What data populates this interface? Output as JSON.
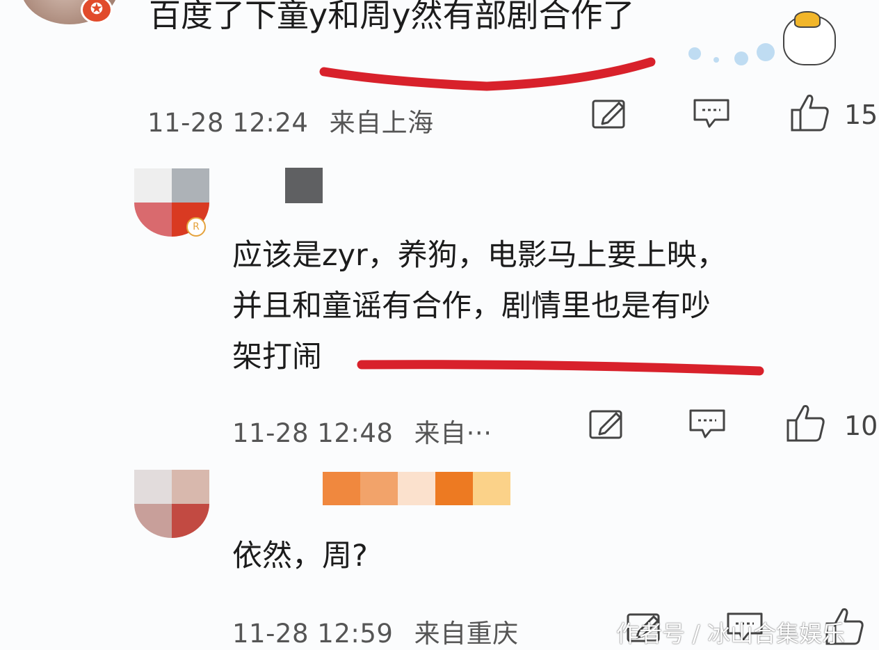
{
  "top_comment": {
    "text": "百度了下童y和周y然有部剧合作了",
    "time": "11-28 12:24",
    "source": "来自上海",
    "like_count": "15"
  },
  "reply_1": {
    "lines": [
      "应该是zyr，养狗，电影马上要上映，",
      "并且和童谣有合作，剧情里也是有吵",
      "架打闹"
    ],
    "time": "11-28 12:48",
    "source": "来自···",
    "like_count": "10"
  },
  "reply_2": {
    "text": "依然，周?",
    "time": "11-28 12:59",
    "source": "来自重庆"
  },
  "watermark": "作者号 / 冰山合集娱乐",
  "icons": {
    "repost": "share-edit-icon",
    "comment": "comment-icon",
    "like": "thumbs-up-icon"
  },
  "colors": {
    "highlight": "#d8212b",
    "badge": "#e14b2b",
    "text": "#1c1c1c",
    "meta": "#555555"
  }
}
